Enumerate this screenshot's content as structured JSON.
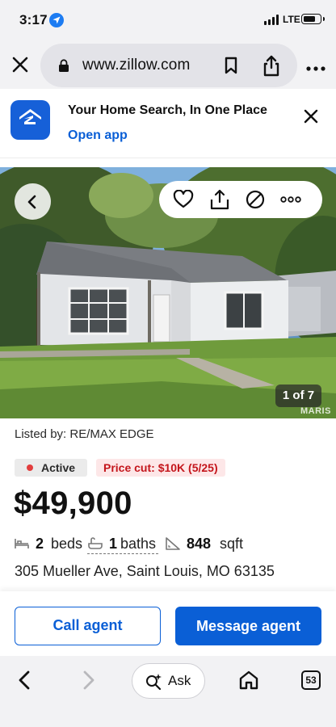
{
  "status_bar": {
    "time": "3:17",
    "network": "LTE",
    "battery_level": 0.75
  },
  "browser": {
    "url": "www.zillow.com"
  },
  "promo": {
    "title": "Your Home Search, In One Place",
    "link": "Open app"
  },
  "photo": {
    "counter": "1 of 7",
    "watermark": "MARIS"
  },
  "listing": {
    "listed_by": "Listed by: RE/MAX EDGE",
    "status": "Active",
    "price_cut": "Price cut: $10K (5/25)",
    "price": "$49,900",
    "beds_num": "2",
    "beds_label": "beds",
    "baths_num": "1",
    "baths_label": "baths",
    "sqft_num": "848",
    "sqft_label": "sqft",
    "address": "305 Mueller Ave, Saint Louis, MO 63135"
  },
  "cta": {
    "call": "Call agent",
    "message": "Message agent"
  },
  "toolbar": {
    "ask": "Ask",
    "tab_count": "53"
  },
  "colors": {
    "brand_blue": "#0a5fd6",
    "zillow_logo": "#1660d8",
    "price_cut_red": "#c4161c",
    "active_dot": "#e23d3d"
  }
}
